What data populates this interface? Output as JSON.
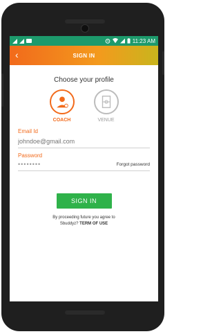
{
  "status": {
    "time": "11:23 AM"
  },
  "appbar": {
    "title": "SIGN IN",
    "back_icon": "chevron-left-icon"
  },
  "profile": {
    "heading": "Choose your profile",
    "options": [
      {
        "label": "COACH",
        "icon": "coach-user-icon",
        "selected": true
      },
      {
        "label": "VENUE",
        "icon": "venue-court-icon",
        "selected": false
      }
    ]
  },
  "form": {
    "email_label": "Email Id",
    "email_placeholder": "johndoe@gmail.com",
    "password_label": "Password",
    "password_value": "••••••••",
    "forgot": "Forgot password"
  },
  "signin_button": "SIGN IN",
  "terms": {
    "line1": "By proceeding future you agree to",
    "line2_prefix": "Sbuddyz?",
    "line2_link": "TERM OF USE"
  },
  "colors": {
    "accent": "#f26a1b",
    "status_bar": "#1d9a6c",
    "button": "#2fb24a"
  }
}
